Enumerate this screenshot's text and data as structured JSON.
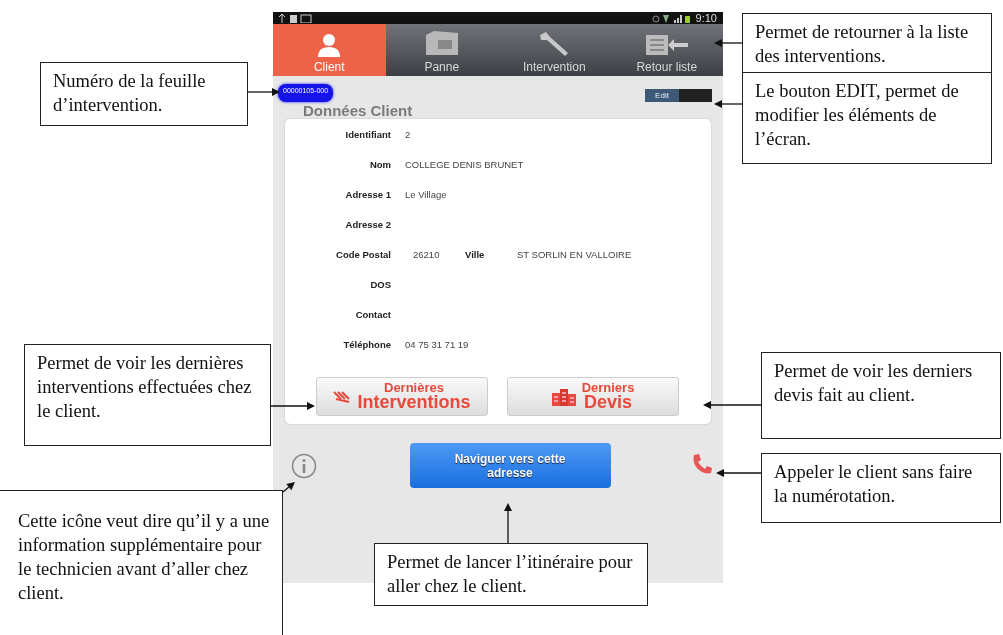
{
  "callouts": [
    {
      "text": "Numéro de la feuille d’intervention."
    },
    {
      "text": "Permet de retourner à la liste des interventions."
    },
    {
      "text": "Le bouton EDIT, permet de modifier les éléments de l’écran."
    },
    {
      "text": "Permet de voir les dernières interventions effectuées chez le client."
    },
    {
      "text": "Permet de voir les derniers devis fait au client."
    },
    {
      "text": "Appeler le client sans faire la numérotation."
    },
    {
      "text": "Cette icône veut dire qu’il y a une information supplémentaire pour le technicien avant d’aller chez client."
    },
    {
      "text": "Permet de lancer l’itinéraire pour aller chez le client."
    }
  ],
  "phone": {
    "status_bar": {
      "time": "9:10"
    },
    "tabs": [
      {
        "label": "Client",
        "selected": true,
        "kind": "person"
      },
      {
        "label": "Panne",
        "selected": false,
        "kind": "panel"
      },
      {
        "label": "Intervention",
        "selected": false,
        "kind": "wrench"
      },
      {
        "label": "Retour liste",
        "selected": false,
        "kind": "back"
      }
    ],
    "sheet_number": "00000105-000",
    "edit_toggle": {
      "label": "Edit"
    },
    "section_title": "Données Client",
    "fields": [
      {
        "label": "Identifiant",
        "value": "2"
      },
      {
        "label": "Nom",
        "value": "COLLEGE DENIS BRUNET"
      },
      {
        "label": "Adresse 1",
        "value": "Le Village"
      },
      {
        "label": "Adresse 2"
      },
      {
        "label": "Code Postal",
        "value": "26210",
        "extra_label": "Ville",
        "extra_value": "ST SORLIN EN VALLOIRE"
      },
      {
        "label": "DOS"
      },
      {
        "label": "Contact"
      },
      {
        "label": "Téléphone",
        "value": "04 75 31 71 19"
      }
    ],
    "history_buttons": [
      {
        "kind": "interventions",
        "line1": "Dernières",
        "line2": "Interventions"
      },
      {
        "kind": "quotes",
        "line1": "Derniers",
        "line2": "Devis"
      }
    ],
    "navigate_button": "Naviguer vers cette adresse"
  }
}
